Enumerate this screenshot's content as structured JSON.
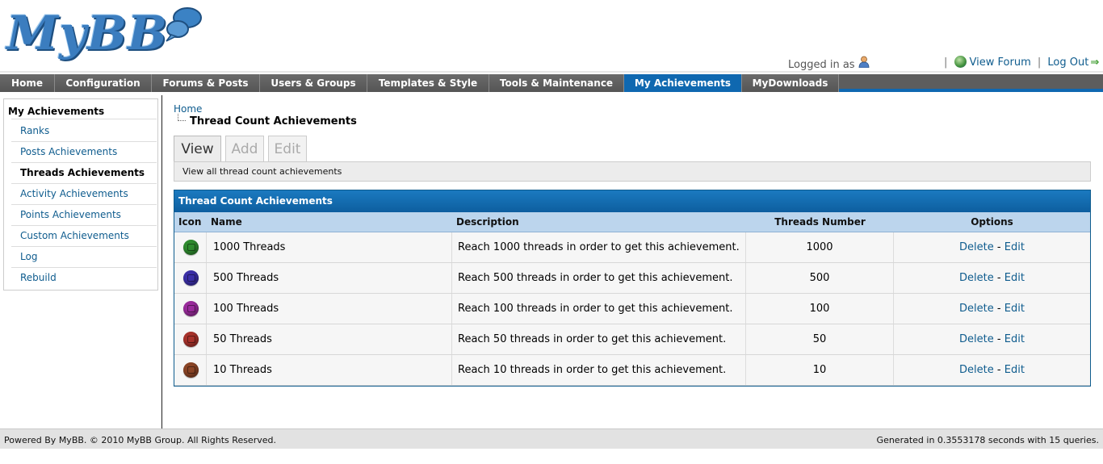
{
  "header": {
    "logo_text": "MyBB",
    "logged_in_label": "Logged in as",
    "view_forum": "View Forum",
    "log_out": "Log Out",
    "separator": "|",
    "arrow": "⇒"
  },
  "nav": {
    "items": [
      {
        "label": "Home"
      },
      {
        "label": "Configuration"
      },
      {
        "label": "Forums & Posts"
      },
      {
        "label": "Users & Groups"
      },
      {
        "label": "Templates & Style"
      },
      {
        "label": "Tools & Maintenance"
      },
      {
        "label": "My Achievements"
      },
      {
        "label": "MyDownloads"
      }
    ],
    "active_index": 6,
    "active_color": "#0f68b0"
  },
  "sidebar": {
    "title": "My Achievements",
    "items": [
      {
        "label": "Ranks"
      },
      {
        "label": "Posts Achievements"
      },
      {
        "label": "Threads Achievements"
      },
      {
        "label": "Activity Achievements"
      },
      {
        "label": "Points Achievements"
      },
      {
        "label": "Custom Achievements"
      },
      {
        "label": "Log"
      },
      {
        "label": "Rebuild"
      }
    ],
    "current_index": 2
  },
  "breadcrumb": {
    "home": "Home",
    "current": "Thread Count Achievements"
  },
  "tabs": {
    "items": [
      {
        "label": "View"
      },
      {
        "label": "Add"
      },
      {
        "label": "Edit"
      }
    ],
    "active_index": 0,
    "description": "View all thread count achievements"
  },
  "table": {
    "title": "Thread Count Achievements",
    "columns": [
      "Icon",
      "Name",
      "Description",
      "Threads Number",
      "Options"
    ],
    "rows": [
      {
        "icon": "green-badge-icon",
        "icon_color": "#2e8b2e",
        "name": "1000 Threads",
        "description": "Reach 1000 threads in order to get this achievement.",
        "number": "1000",
        "delete": "Delete",
        "dash": "-",
        "edit": "Edit"
      },
      {
        "icon": "blue-badge-icon",
        "icon_color": "#3b2fa8",
        "name": "500 Threads",
        "description": "Reach 500 threads in order to get this achievement.",
        "number": "500",
        "delete": "Delete",
        "dash": "-",
        "edit": "Edit"
      },
      {
        "icon": "purple-badge-icon",
        "icon_color": "#9a2b9c",
        "name": "100 Threads",
        "description": "Reach 100 threads in order to get this achievement.",
        "number": "100",
        "delete": "Delete",
        "dash": "-",
        "edit": "Edit"
      },
      {
        "icon": "red-badge-icon",
        "icon_color": "#a8322b",
        "name": "50 Threads",
        "description": "Reach 50 threads in order to get this achievement.",
        "number": "50",
        "delete": "Delete",
        "dash": "-",
        "edit": "Edit"
      },
      {
        "icon": "brown-badge-icon",
        "icon_color": "#8a4425",
        "name": "10 Threads",
        "description": "Reach 10 threads in order to get this achievement.",
        "number": "10",
        "delete": "Delete",
        "dash": "-",
        "edit": "Edit"
      }
    ]
  },
  "footer": {
    "left": "Powered By MyBB. © 2010 MyBB Group. All Rights Reserved.",
    "right": "Generated in 0.3553178 seconds with 15 queries."
  }
}
